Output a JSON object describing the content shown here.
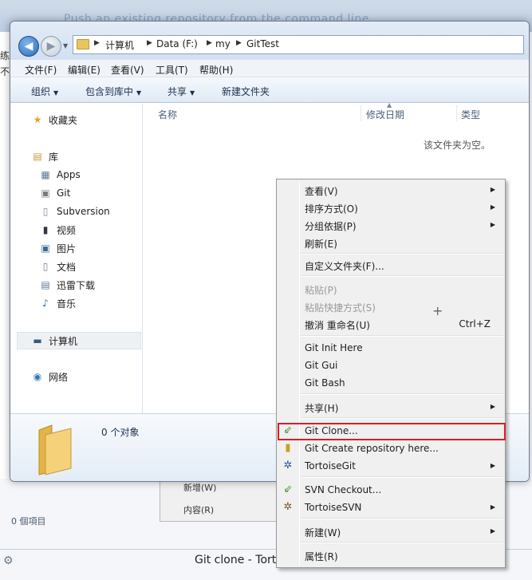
{
  "background": {
    "title": "Push an existing repository from the command line",
    "left_text": "练\n不",
    "items_count": "0 個項目",
    "bottom_caption": "Git clone - Torto",
    "menu_items": [
      "新增(W)",
      "内容(R)"
    ]
  },
  "address": {
    "crumbs": [
      "计算机",
      "Data (F:)",
      "my",
      "GitTest"
    ]
  },
  "menubar": [
    "文件(F)",
    "编辑(E)",
    "查看(V)",
    "工具(T)",
    "帮助(H)"
  ],
  "toolbar": {
    "organize": "组织",
    "include": "包含到库中",
    "share": "共享",
    "new_folder": "新建文件夹"
  },
  "nav": {
    "favorites": "收藏夹",
    "libraries": "库",
    "library_items": [
      "Apps",
      "Git",
      "Subversion",
      "视频",
      "图片",
      "文档",
      "迅雷下载",
      "音乐"
    ],
    "computer": "计算机",
    "network": "网络"
  },
  "columns": [
    "名称",
    "修改日期",
    "类型"
  ],
  "empty_message": "该文件夹为空。",
  "details": {
    "count": "0 个对象"
  },
  "context_menu": {
    "view": "查看(V)",
    "sort": "排序方式(O)",
    "group": "分组依据(P)",
    "refresh": "刷新(E)",
    "customize": "自定义文件夹(F)...",
    "paste": "粘贴(P)",
    "paste_shortcut": "粘贴快捷方式(S)",
    "undo": "撤消 重命名(U)",
    "undo_shortcut": "Ctrl+Z",
    "git_init": "Git Init Here",
    "git_gui": "Git Gui",
    "git_bash": "Git Bash",
    "share": "共享(H)",
    "git_clone": "Git Clone...",
    "git_create": "Git Create repository here...",
    "tortoisegit": "TortoiseGit",
    "svn_checkout": "SVN Checkout...",
    "tortoisesvn": "TortoiseSVN",
    "new": "新建(W)",
    "properties": "属性(R)"
  },
  "colors": {
    "highlight_border": "#d81e25",
    "accent": "#2a6cb8"
  }
}
